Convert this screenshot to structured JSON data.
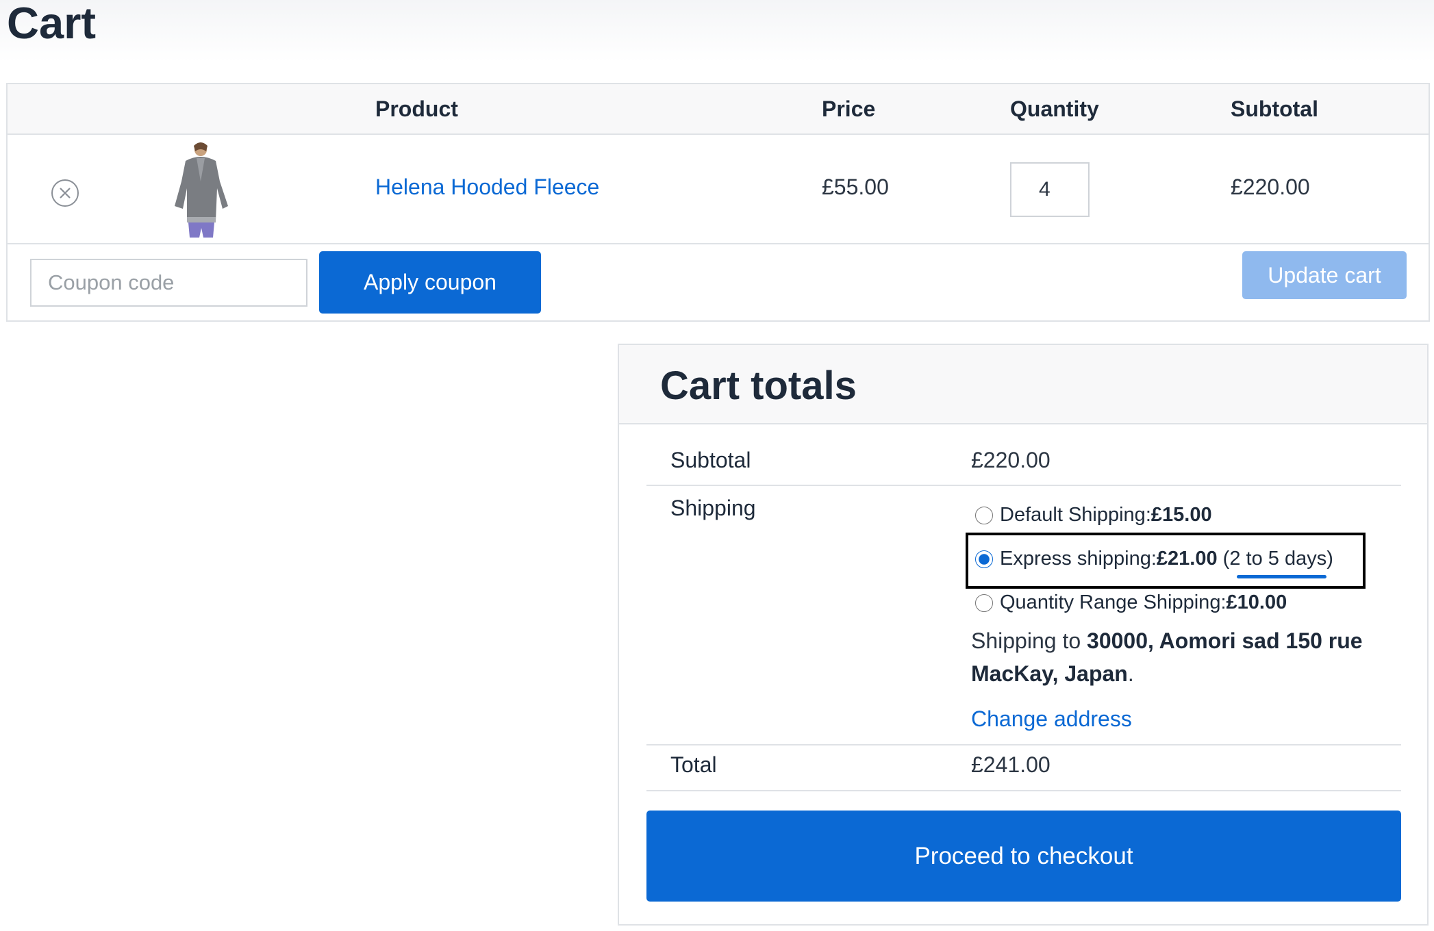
{
  "page": {
    "title": "Cart"
  },
  "cart_table": {
    "headers": {
      "product": "Product",
      "price": "Price",
      "quantity": "Quantity",
      "subtotal": "Subtotal"
    },
    "rows": [
      {
        "name": "Helena Hooded Fleece",
        "price": "£55.00",
        "quantity": "4",
        "subtotal": "£220.00"
      }
    ]
  },
  "coupon": {
    "placeholder": "Coupon code",
    "apply_label": "Apply coupon",
    "update_label": "Update cart"
  },
  "totals": {
    "title": "Cart totals",
    "subtotal_label": "Subtotal",
    "subtotal_value": "£220.00",
    "shipping_label": "Shipping",
    "shipping_options": [
      {
        "label": "Default Shipping: ",
        "price": "£15.00",
        "note": "",
        "selected": false
      },
      {
        "label": "Express shipping: ",
        "price": "£21.00",
        "note": "(2 to 5 days)",
        "selected": true
      },
      {
        "label": "Quantity Range Shipping: ",
        "price": "£10.00",
        "note": "",
        "selected": false
      }
    ],
    "shipping_to_prefix": "Shipping to ",
    "shipping_to_address": "30000, Aomori sad 150 rue MacKay, Japan",
    "shipping_to_suffix": ".",
    "change_address": "Change address",
    "total_label": "Total",
    "total_value": "£241.00",
    "checkout_label": "Proceed to checkout"
  },
  "colors": {
    "accent": "#0b69d4",
    "disabled_button": "#8fb9ee",
    "text": "#1e2a3a",
    "border": "#dfe2e6"
  }
}
